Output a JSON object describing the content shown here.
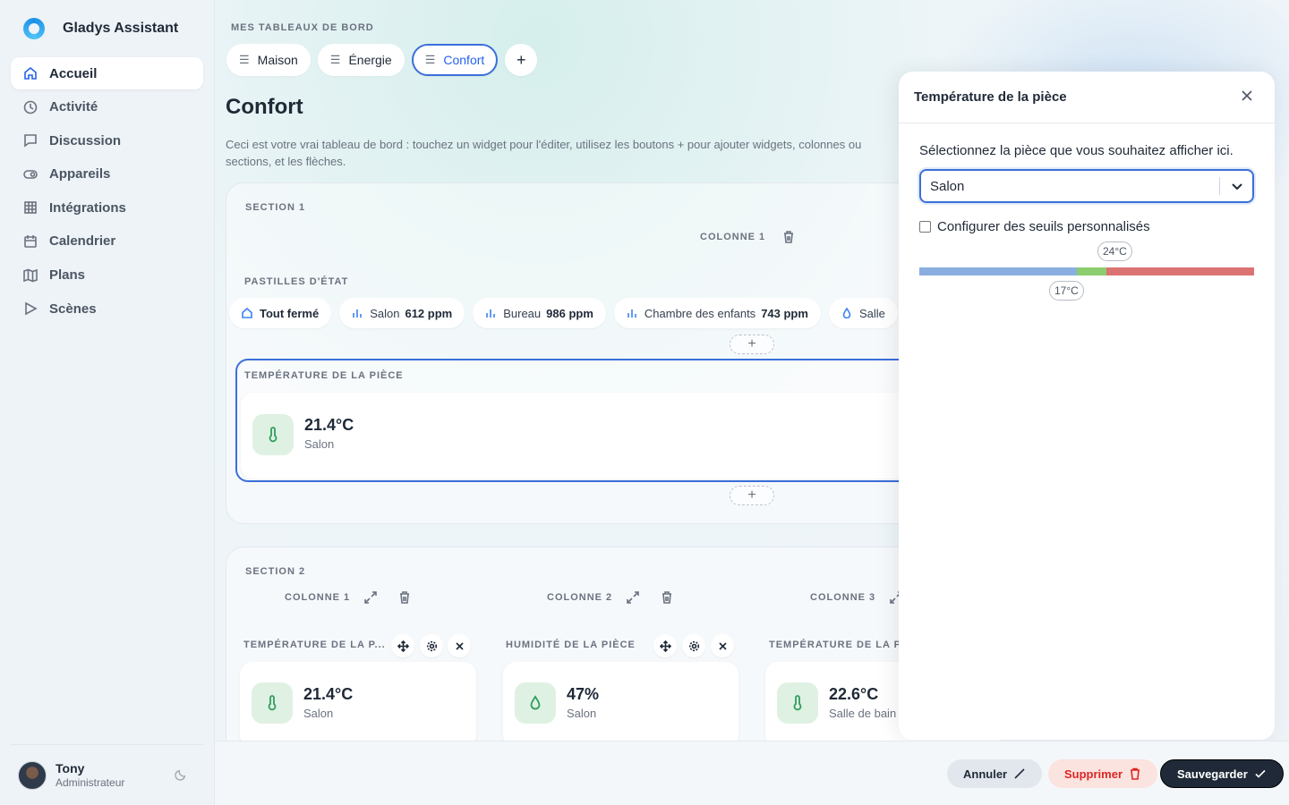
{
  "app": {
    "name": "Gladys Assistant"
  },
  "sidebar": {
    "items": [
      {
        "label": "Accueil",
        "icon": "home-icon",
        "active": true
      },
      {
        "label": "Activité",
        "icon": "clock-icon"
      },
      {
        "label": "Discussion",
        "icon": "chat-icon"
      },
      {
        "label": "Appareils",
        "icon": "toggle-icon"
      },
      {
        "label": "Intégrations",
        "icon": "grid-icon"
      },
      {
        "label": "Calendrier",
        "icon": "calendar-icon"
      },
      {
        "label": "Plans",
        "icon": "map-icon"
      },
      {
        "label": "Scènes",
        "icon": "play-icon"
      }
    ],
    "user": {
      "name": "Tony",
      "role": "Administrateur"
    }
  },
  "dashboard": {
    "section_label": "MES TABLEAUX DE BORD",
    "tabs": [
      {
        "label": "Maison"
      },
      {
        "label": "Énergie"
      },
      {
        "label": "Confort",
        "active": true
      }
    ],
    "add_tab": "+",
    "title": "Confort",
    "description": "Ceci est votre vrai tableau de bord : touchez un widget pour l'éditer, utilisez les boutons + pour ajouter widgets, colonnes ou sections, et les flèches."
  },
  "section1": {
    "title": "SECTION 1",
    "column": "COLONNE 1",
    "chips_label": "PASTILLES D'ÉTAT",
    "chips": [
      {
        "label": "Tout fermé",
        "value": ""
      },
      {
        "label": "Salon",
        "value": "612 ppm"
      },
      {
        "label": "Bureau",
        "value": "986 ppm"
      },
      {
        "label": "Chambre des enfants",
        "value": "743 ppm"
      },
      {
        "label": "Salle",
        "value": ""
      }
    ],
    "add": "+",
    "widget_label": "TEMPÉRATURE DE LA PIÈCE",
    "widget_value": "21.4°C",
    "widget_room": "Salon"
  },
  "section2": {
    "title": "SECTION 2",
    "columns": [
      "COLONNE 1",
      "COLONNE 2",
      "COLONNE 3"
    ],
    "widgets": [
      {
        "label": "TEMPÉRATURE DE LA P...",
        "value": "21.4°C",
        "room": "Salon"
      },
      {
        "label": "HUMIDITÉ DE LA PIÈCE",
        "value": "47%",
        "room": "Salon"
      },
      {
        "label": "TEMPÉRATURE DE LA P",
        "value": "22.6°C",
        "room": "Salle de bain"
      }
    ]
  },
  "panel": {
    "title": "Température de la pièce",
    "description": "Sélectionnez la pièce que vous souhaitez afficher ici.",
    "selected_room": "Salon",
    "checkbox_label": "Configurer des seuils personnalisés",
    "checkbox_checked": false,
    "threshold_high": "24°C",
    "threshold_low": "17°C",
    "colors": {
      "cold": "#8aaee0",
      "comfort": "#8ccd6e",
      "hot": "#dc7373"
    }
  },
  "footer": {
    "cancel": "Annuler",
    "delete": "Supprimer",
    "save": "Sauvegarder"
  }
}
